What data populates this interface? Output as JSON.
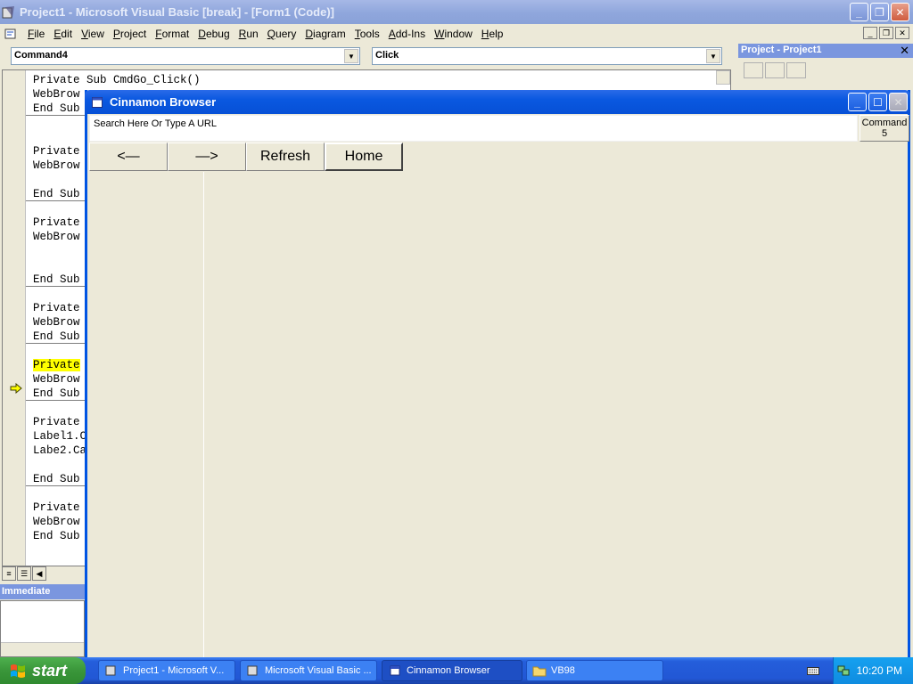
{
  "vb_window": {
    "title": "Project1 - Microsoft Visual Basic [break] - [Form1 (Code)]",
    "caption_buttons": [
      "minimize",
      "restore",
      "close"
    ]
  },
  "menu": [
    "File",
    "Edit",
    "View",
    "Project",
    "Format",
    "Debug",
    "Run",
    "Query",
    "Diagram",
    "Tools",
    "Add-Ins",
    "Window",
    "Help"
  ],
  "code_window": {
    "object_combo": "Command4",
    "procedure_combo": "Click",
    "lines": [
      "Private Sub CmdGo_Click()",
      "WebBrow",
      "End Sub",
      "",
      "",
      "Private",
      "WebBrow",
      "",
      "End Sub",
      "",
      "Private",
      "WebBrow",
      "",
      "",
      "End Sub",
      "",
      "Private",
      "WebBrow",
      "End Sub",
      "",
      "Private",
      "WebBrow",
      "End Sub",
      "",
      "Private",
      "Label1.C",
      "Labe2.Ca",
      "",
      "End Sub",
      "",
      "Private",
      "WebBrow",
      "End Sub"
    ],
    "highlighted_line_index": 20
  },
  "immediate": {
    "title": "Immediate"
  },
  "project_explorer": {
    "title": "Project - Project1"
  },
  "browser_form": {
    "title": "Cinnamon Browser",
    "url_text": "Search Here Or Type A URL",
    "command5_label": "Command\n5",
    "back_label": "<—",
    "forward_label": "—>",
    "refresh_label": "Refresh",
    "home_label": "Home"
  },
  "taskbar": {
    "start_label": "start",
    "items": [
      {
        "label": "Project1 - Microsoft V...",
        "icon": "vb-icon"
      },
      {
        "label": "Microsoft Visual Basic ...",
        "icon": "vb-icon"
      },
      {
        "label": "Cinnamon Browser",
        "icon": "form-icon"
      },
      {
        "label": "VB98",
        "icon": "folder-icon"
      }
    ],
    "clock": "10:20 PM"
  },
  "colors": {
    "xp_blue": "#0054e3",
    "highlight_yellow": "#ffff00",
    "start_green": "#3a963a"
  }
}
